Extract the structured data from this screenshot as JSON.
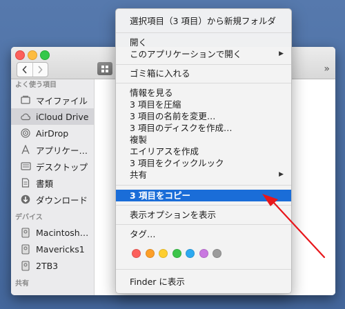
{
  "colors": {
    "desktop": "#4a6ea3",
    "menu_highlight": "#1a6dd8",
    "annotation_arrow": "#e8161b"
  },
  "finder": {
    "overflow_label": "»",
    "sidebar": {
      "favorites_header": "よく使う項目",
      "favorites": [
        {
          "label": "マイファイル",
          "icon": "all-my-files-icon"
        },
        {
          "label": "iCloud Drive",
          "icon": "icloud-icon",
          "selected": true
        },
        {
          "label": "AirDrop",
          "icon": "airdrop-icon"
        },
        {
          "label": "アプリケー…",
          "icon": "applications-icon"
        },
        {
          "label": "デスクトップ",
          "icon": "desktop-icon"
        },
        {
          "label": "書類",
          "icon": "documents-icon"
        },
        {
          "label": "ダウンロード",
          "icon": "downloads-icon"
        }
      ],
      "devices_header": "デバイス",
      "devices": [
        {
          "label": "Macintosh…",
          "icon": "hard-drive-icon"
        },
        {
          "label": "Mavericks1",
          "icon": "hard-drive-icon"
        },
        {
          "label": "2TB3",
          "icon": "hard-drive-icon"
        }
      ],
      "shared_header": "共有"
    }
  },
  "context_menu": {
    "new_folder_with_selection": "選択項目（3 項目）から新規フォルダ",
    "open": "開く",
    "open_with": "このアプリケーションで開く",
    "move_to_trash": "ゴミ箱に入れる",
    "get_info": "情報を見る",
    "compress": "3 項目を圧縮",
    "rename": "3 項目の名前を変更…",
    "burn": "3 項目のディスクを作成…",
    "duplicate": "複製",
    "make_alias": "エイリアスを作成",
    "quick_look": "3 項目をクイックルック",
    "share": "共有",
    "copy": "3 項目をコピー",
    "show_view_options": "表示オプションを表示",
    "tags": "タグ…",
    "tag_colors": [
      "#fc605c",
      "#fd9f28",
      "#fece2f",
      "#3dc54a",
      "#2da9f0",
      "#c978e0",
      "#9b9b9b"
    ],
    "show_in_finder": "Finder に表示"
  }
}
